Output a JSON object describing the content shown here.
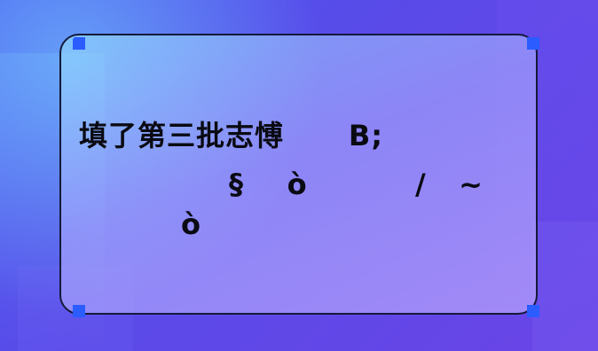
{
  "headline": {
    "line1": "填了第三批志愽      B;",
    "line2": "§    ò          /   ~",
    "line3": "ò"
  }
}
